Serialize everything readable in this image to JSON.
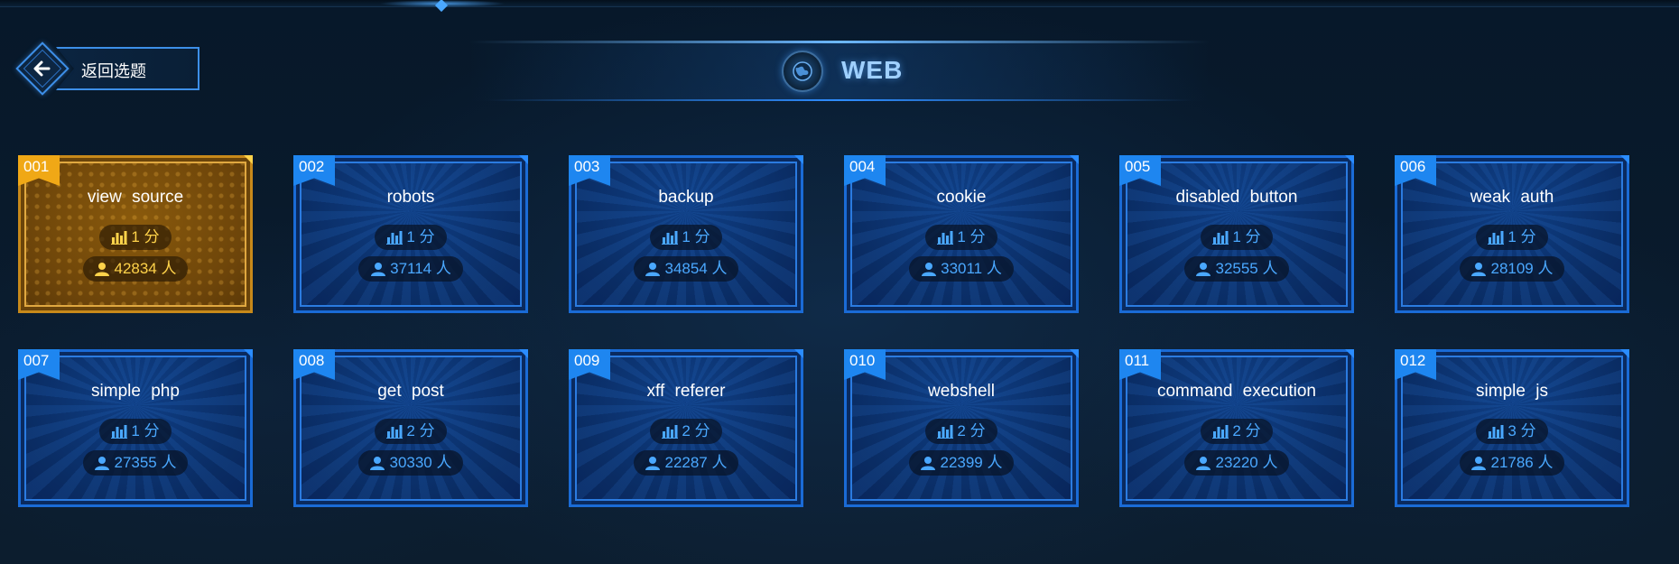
{
  "nav": {
    "back_label": "返回选题"
  },
  "header": {
    "category": "WEB",
    "icon": "globe-icon"
  },
  "units": {
    "score": "分",
    "people": "人"
  },
  "colors": {
    "accent": "#1e86f0",
    "active": "#f0a816",
    "title": "#9fd0ff"
  },
  "challenges": [
    {
      "num": "001",
      "title": "view source",
      "score": "1",
      "solvers": "42834",
      "active": true
    },
    {
      "num": "002",
      "title": "robots",
      "score": "1",
      "solvers": "37114",
      "active": false
    },
    {
      "num": "003",
      "title": "backup",
      "score": "1",
      "solvers": "34854",
      "active": false
    },
    {
      "num": "004",
      "title": "cookie",
      "score": "1",
      "solvers": "33011",
      "active": false
    },
    {
      "num": "005",
      "title": "disabled button",
      "score": "1",
      "solvers": "32555",
      "active": false
    },
    {
      "num": "006",
      "title": "weak auth",
      "score": "1",
      "solvers": "28109",
      "active": false
    },
    {
      "num": "007",
      "title": "simple php",
      "score": "1",
      "solvers": "27355",
      "active": false
    },
    {
      "num": "008",
      "title": "get post",
      "score": "2",
      "solvers": "30330",
      "active": false
    },
    {
      "num": "009",
      "title": "xff referer",
      "score": "2",
      "solvers": "22287",
      "active": false
    },
    {
      "num": "010",
      "title": "webshell",
      "score": "2",
      "solvers": "22399",
      "active": false
    },
    {
      "num": "011",
      "title": "command execution",
      "score": "2",
      "solvers": "23220",
      "active": false
    },
    {
      "num": "012",
      "title": "simple js",
      "score": "3",
      "solvers": "21786",
      "active": false
    }
  ]
}
